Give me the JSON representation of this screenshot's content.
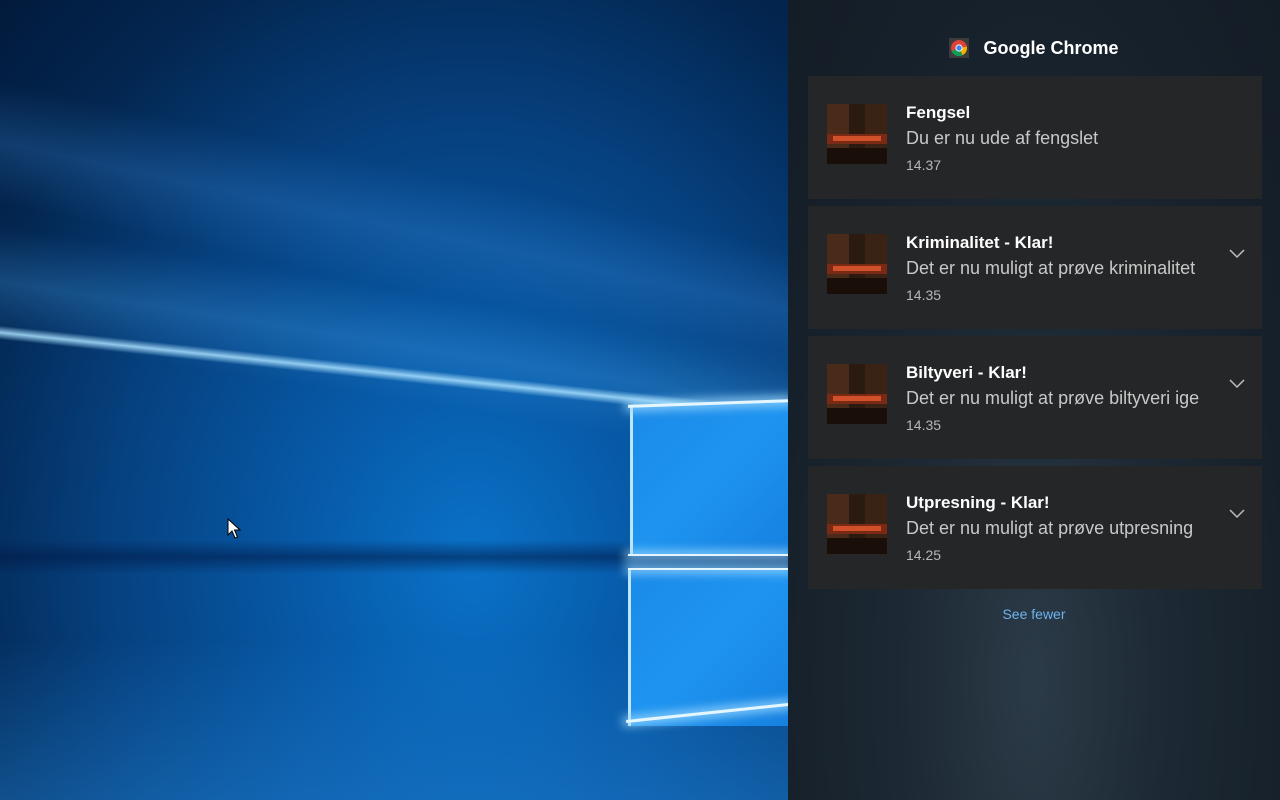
{
  "action_center": {
    "app_name": "Google Chrome",
    "app_icon": "chrome-icon",
    "notifications": [
      {
        "title": "Fengsel",
        "body": "Du er nu ude af fengslet",
        "time": "14.37",
        "expandable": false,
        "thumbnail": "game-thumbnail"
      },
      {
        "title": "Kriminalitet - Klar!",
        "body": "Det er nu muligt at prøve kriminalitet",
        "time": "14.35",
        "expandable": true,
        "thumbnail": "game-thumbnail"
      },
      {
        "title": "Biltyveri - Klar!",
        "body": "Det er nu muligt at prøve biltyveri ige",
        "time": "14.35",
        "expandable": true,
        "thumbnail": "game-thumbnail"
      },
      {
        "title": "Utpresning - Klar!",
        "body": "Det er nu muligt at prøve utpresning",
        "time": "14.25",
        "expandable": true,
        "thumbnail": "game-thumbnail"
      }
    ],
    "see_fewer_label": "See fewer"
  },
  "colors": {
    "panel_bg": "#1c2833",
    "card_bg": "#252628",
    "link": "#6fb3f0",
    "desktop_blue": "#0a72c8"
  }
}
